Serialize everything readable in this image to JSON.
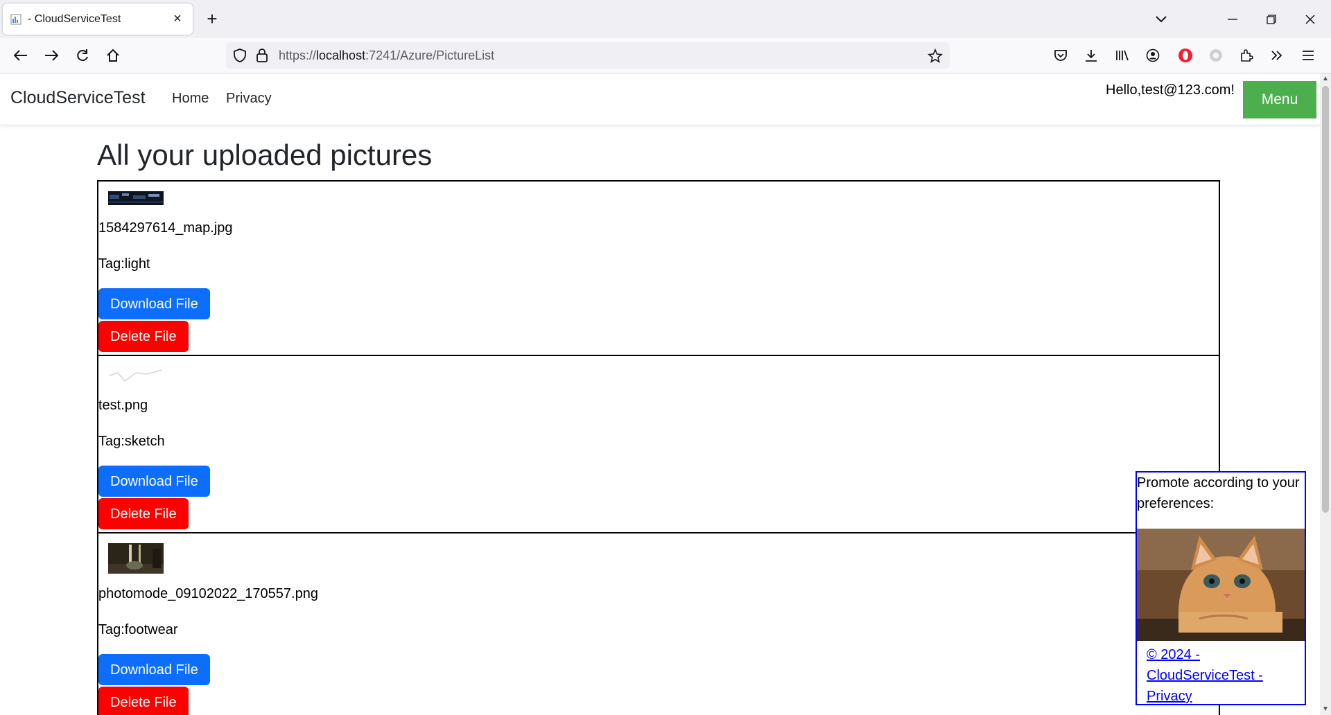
{
  "browser": {
    "tab_title": "- CloudServiceTest",
    "url_prefix": "https://",
    "url_host": "localhost",
    "url_rest": ":7241/Azure/PictureList"
  },
  "site": {
    "brand": "CloudServiceTest",
    "nav": [
      "Home",
      "Privacy"
    ],
    "greeting": "Hello,test@123.com!",
    "menu_label": "Menu"
  },
  "page": {
    "title": "All your uploaded pictures",
    "pictures": [
      {
        "file": "1584297614_map.jpg",
        "tag": "Tag:light",
        "download_label": "Download File",
        "delete_label": "Delete File"
      },
      {
        "file": "test.png",
        "tag": "Tag:sketch",
        "download_label": "Download File",
        "delete_label": "Delete File"
      },
      {
        "file": "photomode_09102022_170557.png",
        "tag": "Tag:footwear",
        "download_label": "Download File",
        "delete_label": "Delete File"
      }
    ]
  },
  "promo": {
    "text": "Promote according to your preferences:",
    "footer_link": "© 2024 - CloudServiceTest - Privacy"
  },
  "colors": {
    "download": "#0d6efd",
    "delete": "#ff0000",
    "menu": "#4cae4c",
    "promo_border": "#0000ff"
  }
}
